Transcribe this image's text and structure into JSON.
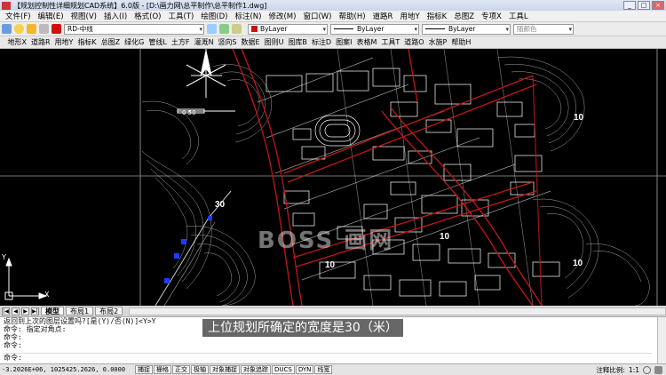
{
  "window": {
    "title": "【规划控制性详细规划CAD系统】6.0版 - [D:\\画力网\\总平制作\\总平制作1.dwg]",
    "buttons": [
      "_",
      "□",
      "×"
    ]
  },
  "menubar": {
    "items": [
      "文件(F)",
      "编辑(E)",
      "视图(V)",
      "插入(I)",
      "格式(O)",
      "工具(T)",
      "绘图(D)",
      "标注(N)",
      "修改(M)",
      "窗口(W)",
      "帮助(H)",
      "道路R",
      "用地Y",
      "指标K",
      "总图Z",
      "专项X",
      "工具L"
    ]
  },
  "toolbar1": {
    "layer_value": "RD-中线",
    "color_value": "ByLayer",
    "linetype_value": "ByLayer",
    "lineweight_value": "ByLayer",
    "plotstyle_value": "随颜色",
    "colors": {
      "layer_swatch": "#d01010",
      "color_swatch": "#d01010"
    }
  },
  "toolbar2": {
    "items": [
      "地形X",
      "道路R",
      "用地Y",
      "指标K",
      "总图Z",
      "绿化G",
      "管线L",
      "土方F",
      "灌溉N",
      "竖向S",
      "数据E",
      "图则U",
      "图库B",
      "标注D",
      "图案I",
      "表格M",
      "工具T",
      "道路O",
      "水施P",
      "帮助H"
    ]
  },
  "drawing": {
    "labels": {
      "label_30": "30",
      "label_10a": "10",
      "label_10b": "10",
      "label_10c": "10",
      "label_10d": "10"
    },
    "scale_text": "0   50",
    "watermark": "BOSS 画网",
    "ucs": {
      "y": "Y",
      "x": "X"
    },
    "colors": {
      "background": "#000000",
      "roads": "#c01818",
      "linework": "#ffffff",
      "blue_marks": "#1e3cff"
    }
  },
  "tabs": {
    "items": [
      "模型",
      "布局1",
      "布局2"
    ],
    "active": "模型"
  },
  "command": {
    "lines": [
      "返回到上次的图层设置吗?[是(Y)/否(N)]<Y>Y",
      "命令: 指定对角点:",
      "命令:",
      "命令:"
    ],
    "input_prompt": "命令:"
  },
  "subtitle": "上位规划所确定的宽度是30（米）",
  "statusbar": {
    "coords": "-3.2026E+06, 1025425.2626, 0.0000",
    "toggles": [
      "捕捉",
      "栅格",
      "正交",
      "极轴",
      "对象捕捉",
      "对象追踪",
      "DUCS",
      "DYN",
      "线宽"
    ],
    "annotation_scale_label": "注释比例:",
    "annotation_scale_value": "1:1"
  }
}
